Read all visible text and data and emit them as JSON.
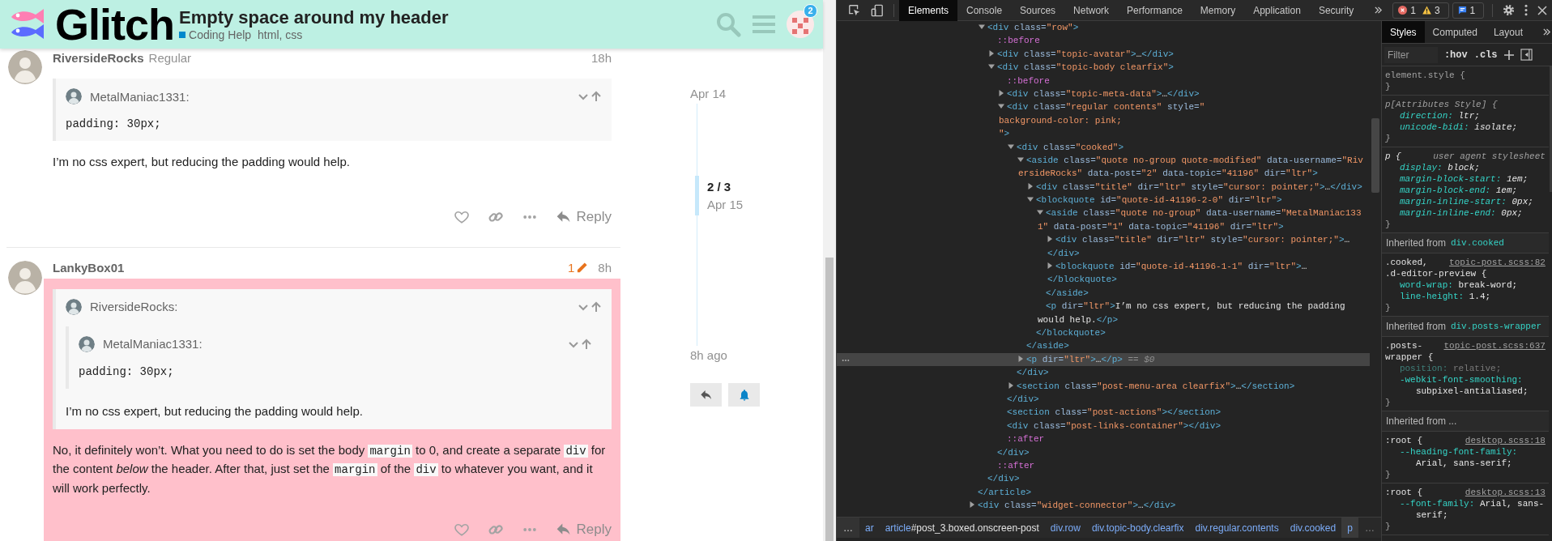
{
  "header": {
    "logo": "Glitch",
    "title": "Empty space around my header",
    "category": {
      "name": "Coding Help",
      "color": "#0088cc"
    },
    "tags": "html, css",
    "notifications": "2"
  },
  "posts": [
    {
      "author": "RiversideRocks",
      "user_title": "Regular",
      "time": "18h",
      "color": "#ffffff",
      "quote": {
        "author": "MetalManiac1331:",
        "code": "padding: 30px;"
      },
      "paragraphs": [
        [
          {
            "kind": "text",
            "text": "I’m no css expert, but reducing the padding would help."
          }
        ]
      ],
      "reply": "Reply"
    },
    {
      "author": "LankyBox01",
      "edits": "1",
      "time": "8h",
      "color": "#ffc0cb",
      "quote": {
        "author": "RiversideRocks:",
        "quote": {
          "author": "MetalManiac1331:",
          "code": "padding: 30px;"
        },
        "text": "I’m no css expert, but reducing the padding would help."
      },
      "paragraphs": [
        [
          {
            "kind": "text",
            "text": "No, it definitely won’t. What you need to do is set the body "
          },
          {
            "kind": "code",
            "text": "margin"
          },
          {
            "kind": "text",
            "text": " to 0, and create a separate "
          },
          {
            "kind": "code",
            "text": "div"
          },
          {
            "kind": "text",
            "text": " for the content *below* the header. After that, just set the "
          },
          {
            "kind": "code",
            "text": "margin"
          },
          {
            "kind": "text",
            "text": " of the "
          },
          {
            "kind": "code",
            "text": "div"
          },
          {
            "kind": "text",
            "text": " to whatever you want, and it will work perfectly."
          }
        ]
      ],
      "reply": "Reply"
    }
  ],
  "timeline": {
    "start": "Apr 14",
    "position": "2 / 3",
    "position_date": "Apr 15",
    "end": "8h ago"
  },
  "devtools": {
    "tabs": [
      {
        "label": "Elements",
        "selected": true
      },
      {
        "label": "Console",
        "selected": false
      },
      {
        "label": "Sources",
        "selected": false
      },
      {
        "label": "Network",
        "selected": false
      },
      {
        "label": "Performance",
        "selected": false
      },
      {
        "label": "Memory",
        "selected": false
      },
      {
        "label": "Application",
        "selected": false
      },
      {
        "label": "Security",
        "selected": false
      }
    ],
    "issues": {
      "errors": "1",
      "warnings": "3",
      "messages": "1"
    },
    "dom_tree": [
      {
        "children": [
          {
            "lines": [
              [
                {
                  "kind": "tag",
                  "text": "<div"
                },
                {
                  "kind": "attr",
                  "text": " class="
                },
                {
                  "kind": "value",
                  "text": "\"row\""
                },
                {
                  "kind": "tag",
                  "text": ">"
                }
              ]
            ],
            "expanded": true,
            "selected": false,
            "children": [
              {
                "lines": [
                  [
                    {
                      "kind": "pseudo",
                      "text": "::before"
                    }
                  ]
                ],
                "selected": false
              },
              {
                "lines": [
                  [
                    {
                      "kind": "tag",
                      "text": "<div"
                    },
                    {
                      "kind": "attr",
                      "text": " class="
                    },
                    {
                      "kind": "value",
                      "text": "\"topic-avatar\""
                    },
                    {
                      "kind": "tag",
                      "text": ">"
                    },
                    {
                      "kind": "text",
                      "text": "…"
                    },
                    {
                      "kind": "tag",
                      "text": "</div>"
                    }
                  ]
                ],
                "expanded": false,
                "selected": false
              },
              {
                "lines": [
                  [
                    {
                      "kind": "tag",
                      "text": "<div"
                    },
                    {
                      "kind": "attr",
                      "text": " class="
                    },
                    {
                      "kind": "value",
                      "text": "\"topic-body clearfix\""
                    },
                    {
                      "kind": "tag",
                      "text": ">"
                    }
                  ]
                ],
                "expanded": true,
                "selected": false,
                "children": [
                  {
                    "lines": [
                      [
                        {
                          "kind": "pseudo",
                          "text": "::before"
                        }
                      ]
                    ],
                    "selected": false
                  },
                  {
                    "lines": [
                      [
                        {
                          "kind": "tag",
                          "text": "<div"
                        },
                        {
                          "kind": "attr",
                          "text": " class="
                        },
                        {
                          "kind": "value",
                          "text": "\"topic-meta-data\""
                        },
                        {
                          "kind": "tag",
                          "text": ">"
                        },
                        {
                          "kind": "text",
                          "text": "…"
                        },
                        {
                          "kind": "tag",
                          "text": "</div>"
                        }
                      ]
                    ],
                    "expanded": false,
                    "selected": false
                  },
                  {
                    "lines": [
                      [
                        {
                          "kind": "tag",
                          "text": "<div"
                        },
                        {
                          "kind": "attr",
                          "text": " class="
                        },
                        {
                          "kind": "value",
                          "text": "\"regular contents\""
                        },
                        {
                          "kind": "attr",
                          "text": " style="
                        },
                        {
                          "kind": "value",
                          "text": "\""
                        }
                      ],
                      [
                        {
                          "kind": "value",
                          "text": "background-color: pink;"
                        }
                      ],
                      [
                        {
                          "kind": "value",
                          "text": "\""
                        },
                        {
                          "kind": "tag",
                          "text": ">"
                        }
                      ]
                    ],
                    "expanded": true,
                    "selected": false,
                    "children": [
                      {
                        "lines": [
                          [
                            {
                              "kind": "tag",
                              "text": "<div"
                            },
                            {
                              "kind": "attr",
                              "text": " class="
                            },
                            {
                              "kind": "value",
                              "text": "\"cooked\""
                            },
                            {
                              "kind": "tag",
                              "text": ">"
                            }
                          ]
                        ],
                        "expanded": true,
                        "selected": false,
                        "children": [
                          {
                            "lines": [
                              [
                                {
                                  "kind": "tag",
                                  "text": "<aside"
                                },
                                {
                                  "kind": "attr",
                                  "text": " class="
                                },
                                {
                                  "kind": "value",
                                  "text": "\"quote no-group quote-modified\""
                                },
                                {
                                  "kind": "attr",
                                  "text": " data-username="
                                },
                                {
                                  "kind": "value",
                                  "text": "\"Riv"
                                }
                              ],
                              [
                                {
                                  "kind": "value",
                                  "text": "ersideRocks\""
                                },
                                {
                                  "kind": "attr",
                                  "text": " data-post="
                                },
                                {
                                  "kind": "value",
                                  "text": "\"2\""
                                },
                                {
                                  "kind": "attr",
                                  "text": " data-topic="
                                },
                                {
                                  "kind": "value",
                                  "text": "\"41196\""
                                },
                                {
                                  "kind": "attr",
                                  "text": " dir="
                                },
                                {
                                  "kind": "value",
                                  "text": "\"ltr\""
                                },
                                {
                                  "kind": "tag",
                                  "text": ">"
                                }
                              ]
                            ],
                            "expanded": true,
                            "selected": false,
                            "children": [
                              {
                                "lines": [
                                  [
                                    {
                                      "kind": "tag",
                                      "text": "<div"
                                    },
                                    {
                                      "kind": "attr",
                                      "text": " class="
                                    },
                                    {
                                      "kind": "value",
                                      "text": "\"title\""
                                    },
                                    {
                                      "kind": "attr",
                                      "text": " dir="
                                    },
                                    {
                                      "kind": "value",
                                      "text": "\"ltr\""
                                    },
                                    {
                                      "kind": "attr",
                                      "text": " style="
                                    },
                                    {
                                      "kind": "value",
                                      "text": "\"cursor: pointer;\""
                                    },
                                    {
                                      "kind": "tag",
                                      "text": ">"
                                    },
                                    {
                                      "kind": "text",
                                      "text": "…"
                                    },
                                    {
                                      "kind": "tag",
                                      "text": "</div>"
                                    }
                                  ]
                                ],
                                "expanded": false,
                                "selected": false
                              },
                              {
                                "lines": [
                                  [
                                    {
                                      "kind": "tag",
                                      "text": "<blockquote"
                                    },
                                    {
                                      "kind": "attr",
                                      "text": " id="
                                    },
                                    {
                                      "kind": "value",
                                      "text": "\"quote-id-41196-2-0\""
                                    },
                                    {
                                      "kind": "attr",
                                      "text": " dir="
                                    },
                                    {
                                      "kind": "value",
                                      "text": "\"ltr\""
                                    },
                                    {
                                      "kind": "tag",
                                      "text": ">"
                                    }
                                  ]
                                ],
                                "expanded": true,
                                "selected": false,
                                "children": [
                                  {
                                    "lines": [
                                      [
                                        {
                                          "kind": "tag",
                                          "text": "<aside"
                                        },
                                        {
                                          "kind": "attr",
                                          "text": " class="
                                        },
                                        {
                                          "kind": "value",
                                          "text": "\"quote no-group\""
                                        },
                                        {
                                          "kind": "attr",
                                          "text": " data-username="
                                        },
                                        {
                                          "kind": "value",
                                          "text": "\"MetalManiac133"
                                        }
                                      ],
                                      [
                                        {
                                          "kind": "value",
                                          "text": "1\""
                                        },
                                        {
                                          "kind": "attr",
                                          "text": " data-post="
                                        },
                                        {
                                          "kind": "value",
                                          "text": "\"1\""
                                        },
                                        {
                                          "kind": "attr",
                                          "text": " data-topic="
                                        },
                                        {
                                          "kind": "value",
                                          "text": "\"41196\""
                                        },
                                        {
                                          "kind": "attr",
                                          "text": " dir="
                                        },
                                        {
                                          "kind": "value",
                                          "text": "\"ltr\""
                                        },
                                        {
                                          "kind": "tag",
                                          "text": ">"
                                        }
                                      ]
                                    ],
                                    "expanded": true,
                                    "selected": false,
                                    "children": [
                                      {
                                        "lines": [
                                          [
                                            {
                                              "kind": "tag",
                                              "text": "<div"
                                            },
                                            {
                                              "kind": "attr",
                                              "text": " class="
                                            },
                                            {
                                              "kind": "value",
                                              "text": "\"title\""
                                            },
                                            {
                                              "kind": "attr",
                                              "text": " dir="
                                            },
                                            {
                                              "kind": "value",
                                              "text": "\"ltr\""
                                            },
                                            {
                                              "kind": "attr",
                                              "text": " style="
                                            },
                                            {
                                              "kind": "value",
                                              "text": "\"cursor: pointer;\""
                                            },
                                            {
                                              "kind": "tag",
                                              "text": ">"
                                            },
                                            {
                                              "kind": "text",
                                              "text": "…"
                                            }
                                          ],
                                          [
                                            {
                                              "kind": "tag",
                                              "text": "</div>"
                                            }
                                          ]
                                        ],
                                        "expanded": false,
                                        "selected": false
                                      },
                                      {
                                        "lines": [
                                          [
                                            {
                                              "kind": "tag",
                                              "text": "<blockquote"
                                            },
                                            {
                                              "kind": "attr",
                                              "text": " id="
                                            },
                                            {
                                              "kind": "value",
                                              "text": "\"quote-id-41196-1-1\""
                                            },
                                            {
                                              "kind": "attr",
                                              "text": " dir="
                                            },
                                            {
                                              "kind": "value",
                                              "text": "\"ltr\""
                                            },
                                            {
                                              "kind": "tag",
                                              "text": ">"
                                            },
                                            {
                                              "kind": "text",
                                              "text": "…"
                                            }
                                          ],
                                          [
                                            {
                                              "kind": "tag",
                                              "text": "</blockquote>"
                                            }
                                          ]
                                        ],
                                        "expanded": false,
                                        "selected": false
                                      }
                                    ],
                                    "close": [
                                      {
                                        "kind": "tag",
                                        "text": "</aside>"
                                      }
                                    ]
                                  },
                                  {
                                    "lines": [
                                      [
                                        {
                                          "kind": "tag",
                                          "text": "<p"
                                        },
                                        {
                                          "kind": "attr",
                                          "text": " dir="
                                        },
                                        {
                                          "kind": "value",
                                          "text": "\"ltr\""
                                        },
                                        {
                                          "kind": "tag",
                                          "text": ">"
                                        },
                                        {
                                          "kind": "text",
                                          "text": "I’m no css expert, but reducing the padding"
                                        }
                                      ],
                                      [
                                        {
                                          "kind": "text",
                                          "text": "would help."
                                        },
                                        {
                                          "kind": "tag",
                                          "text": "</p>"
                                        }
                                      ]
                                    ],
                                    "selected": false
                                  }
                                ],
                                "close": [
                                  {
                                    "kind": "tag",
                                    "text": "</blockquote>"
                                  }
                                ]
                              }
                            ],
                            "close": [
                              {
                                "kind": "tag",
                                "text": "</aside>"
                              }
                            ]
                          },
                          {
                            "lines": [
                              [
                                {
                                  "kind": "tag",
                                  "text": "<p"
                                },
                                {
                                  "kind": "attr",
                                  "text": " dir="
                                },
                                {
                                  "kind": "value",
                                  "text": "\"ltr\""
                                },
                                {
                                  "kind": "tag",
                                  "text": ">"
                                },
                                {
                                  "kind": "text",
                                  "text": "…"
                                },
                                {
                                  "kind": "tag",
                                  "text": "</p>"
                                },
                                {
                                  "kind": "dim",
                                  "text": " == $0"
                                }
                              ]
                            ],
                            "expanded": false,
                            "selected": true
                          }
                        ],
                        "close": [
                          {
                            "kind": "tag",
                            "text": "</div>"
                          }
                        ]
                      },
                      {
                        "lines": [
                          [
                            {
                              "kind": "tag",
                              "text": "<section"
                            },
                            {
                              "kind": "attr",
                              "text": " class="
                            },
                            {
                              "kind": "value",
                              "text": "\"post-menu-area clearfix\""
                            },
                            {
                              "kind": "tag",
                              "text": ">"
                            },
                            {
                              "kind": "text",
                              "text": "…"
                            },
                            {
                              "kind": "tag",
                              "text": "</section>"
                            }
                          ]
                        ],
                        "expanded": false,
                        "selected": false
                      }
                    ],
                    "close": [
                      {
                        "kind": "tag",
                        "text": "</div>"
                      }
                    ]
                  },
                  {
                    "lines": [
                      [
                        {
                          "kind": "tag",
                          "text": "<section"
                        },
                        {
                          "kind": "attr",
                          "text": " class="
                        },
                        {
                          "kind": "value",
                          "text": "\"post-actions\""
                        },
                        {
                          "kind": "tag",
                          "text": "></section>"
                        }
                      ]
                    ],
                    "selected": false
                  },
                  {
                    "lines": [
                      [
                        {
                          "kind": "tag",
                          "text": "<div"
                        },
                        {
                          "kind": "attr",
                          "text": " class="
                        },
                        {
                          "kind": "value",
                          "text": "\"post-links-container\""
                        },
                        {
                          "kind": "tag",
                          "text": "></div>"
                        }
                      ]
                    ],
                    "selected": false
                  },
                  {
                    "lines": [
                      [
                        {
                          "kind": "pseudo",
                          "text": "::after"
                        }
                      ]
                    ],
                    "selected": false
                  }
                ],
                "close": [
                  {
                    "kind": "tag",
                    "text": "</div>"
                  }
                ]
              },
              {
                "lines": [
                  [
                    {
                      "kind": "pseudo",
                      "text": "::after"
                    }
                  ]
                ],
                "selected": false
              }
            ],
            "close": [
              {
                "kind": "tag",
                "text": "</div>"
              }
            ]
          }
        ],
        "close": [
          {
            "kind": "tag",
            "text": "</article>"
          }
        ]
      },
      {
        "lines": [
          [
            {
              "kind": "tag",
              "text": "<div"
            },
            {
              "kind": "attr",
              "text": " class="
            },
            {
              "kind": "value",
              "text": "\"widget-connector\""
            },
            {
              "kind": "tag",
              "text": ">"
            },
            {
              "kind": "text",
              "text": "…"
            },
            {
              "kind": "tag",
              "text": "</div>"
            }
          ]
        ],
        "expanded": false,
        "selected": false
      }
    ],
    "breadcrumbs": {
      "scroll_left": "…",
      "items": [
        {
          "label": "ar",
          "selected": false
        },
        {
          "label": "article",
          "detail": "#post_3.boxed.onscreen-post",
          "selected": false
        },
        {
          "label": "div.row",
          "selected": false
        },
        {
          "label": "div.topic-body.clearfix",
          "selected": false
        },
        {
          "label": "div.regular.contents",
          "selected": false
        },
        {
          "label": "div.cooked",
          "selected": false
        },
        {
          "label": "p",
          "selected": true
        }
      ],
      "scroll_right": "…"
    },
    "styles": {
      "tabs": [
        {
          "label": "Styles",
          "selected": true
        },
        {
          "label": "Computed",
          "selected": false
        },
        {
          "label": "Layout",
          "selected": false
        }
      ],
      "filter": {
        "placeholder": "Filter"
      },
      "hov": ":hov",
      "cls": ".cls",
      "sections": [
        {
          "kind": "inline-rule",
          "selector": [
            "element.style {"
          ],
          "close": "}"
        },
        {
          "kind": "attribute-rule",
          "selector": [
            "p[Attributes Style] {"
          ],
          "properties": [
            {
              "name": "direction:",
              "value": "ltr;",
              "inactive": false
            },
            {
              "name": "unicode-bidi:",
              "value": "isolate;",
              "inactive": false
            }
          ],
          "close": "}"
        },
        {
          "kind": "ua-rule",
          "selector": [
            "p {"
          ],
          "source": "user agent stylesheet",
          "properties": [
            {
              "name": "display:",
              "value": "block;",
              "inactive": false
            },
            {
              "name": "margin-block-start:",
              "value": "1em;",
              "inactive": false
            },
            {
              "name": "margin-block-end:",
              "value": "1em;",
              "inactive": false
            },
            {
              "name": "margin-inline-start:",
              "value": "0px;",
              "inactive": false
            },
            {
              "name": "margin-inline-end:",
              "value": "0px;",
              "inactive": false
            }
          ],
          "close": "}"
        },
        {
          "kind": "inherited",
          "label": "Inherited from",
          "link": "div.cooked"
        },
        {
          "kind": "rule",
          "selector": [
            ".cooked,",
            ".d-editor-preview {"
          ],
          "source": "topic-post.scss:82",
          "properties": [
            {
              "name": "word-wrap:",
              "value": "break-word;",
              "inactive": false
            },
            {
              "name": "line-height:",
              "value": "1.4;",
              "inactive": false
            }
          ],
          "close": "}"
        },
        {
          "kind": "inherited",
          "label": "Inherited from",
          "link": "div.posts-wrapper"
        },
        {
          "kind": "rule",
          "selector": [
            ".posts-",
            "wrapper {"
          ],
          "source": "topic-post.scss:637",
          "properties": [
            {
              "name": "position:",
              "value": "relative;",
              "inactive": true
            },
            {
              "name": "-webkit-font-smoothing:",
              "value": "subpixel-antialiased;",
              "inactive": false
            }
          ],
          "close": "}"
        },
        {
          "kind": "inherited",
          "label": "Inherited from ..."
        },
        {
          "kind": "rule",
          "selector": [
            ":root {"
          ],
          "source": "desktop.scss:18",
          "properties": [
            {
              "name": "--heading-font-family:",
              "value": "Arial, sans-serif;",
              "inactive": false
            }
          ],
          "close": "}"
        },
        {
          "kind": "rule",
          "selector": [
            ":root {"
          ],
          "source": "desktop.scss:13",
          "properties": [
            {
              "name": "--font-family:",
              "value": "Arial, sans-serif;",
              "inactive": false
            }
          ],
          "close": "}"
        }
      ]
    }
  }
}
